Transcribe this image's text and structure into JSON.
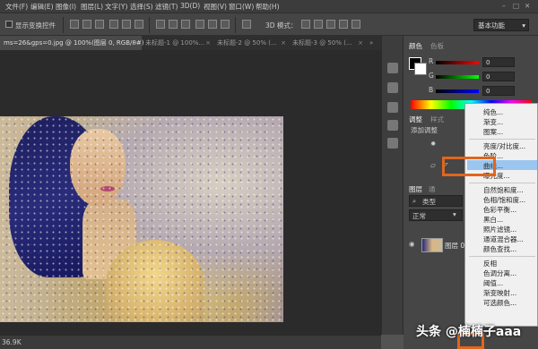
{
  "menubar": {
    "items": [
      "文件(F)",
      "编辑(E)",
      "图像(I)",
      "图层(L)",
      "文字(Y)",
      "选择(S)",
      "滤镜(T)",
      "3D(D)",
      "视图(V)",
      "窗口(W)",
      "帮助(H)"
    ]
  },
  "optionsbar": {
    "show_transform_label": "显示变换控件",
    "mode3d_label": "3D 模式：",
    "workspace_value": "基本功能"
  },
  "tabs": [
    {
      "label": "ms=26&gps=0.jpg @ 100%(图层 0, RGB/8#)",
      "active": true
    },
    {
      "label": "未标题-1 @ 100%...",
      "active": false
    },
    {
      "label": "未标题-2 @ 50% (...",
      "active": false
    },
    {
      "label": "未标题-3 @ 50% (...",
      "active": false
    }
  ],
  "status": {
    "zoom": "36.9K"
  },
  "color_panel": {
    "tabs": [
      "颜色",
      "色板"
    ],
    "rows": [
      {
        "label": "R",
        "value": "0",
        "color": "#e02020"
      },
      {
        "label": "G",
        "value": "0",
        "color": "#20c020"
      },
      {
        "label": "B",
        "value": "0",
        "color": "#2040e0"
      }
    ]
  },
  "adjust_panel": {
    "tabs": [
      "调整",
      "样式"
    ],
    "title": "添加调整"
  },
  "layers_panel": {
    "tabs": [
      "图层",
      "通"
    ],
    "kind_label": "类型",
    "blend_mode": "正常",
    "layer_name": "图层 0"
  },
  "context_menu": {
    "items": [
      {
        "label": "纯色..."
      },
      {
        "label": "渐变..."
      },
      {
        "label": "图案..."
      },
      {
        "sep": true
      },
      {
        "label": "亮度/对比度..."
      },
      {
        "label": "色阶..."
      },
      {
        "label": "曲线...",
        "highlight": true
      },
      {
        "label": "曝光度..."
      },
      {
        "sep": true
      },
      {
        "label": "自然饱和度..."
      },
      {
        "label": "色相/饱和度..."
      },
      {
        "label": "色彩平衡..."
      },
      {
        "label": "黑白..."
      },
      {
        "label": "照片滤镜..."
      },
      {
        "label": "通道混合器..."
      },
      {
        "label": "颜色查找..."
      },
      {
        "sep": true
      },
      {
        "label": "反相"
      },
      {
        "label": "色调分离..."
      },
      {
        "label": "阈值..."
      },
      {
        "label": "渐变映射..."
      },
      {
        "label": "可选颜色..."
      }
    ]
  },
  "watermark": "头条 @楠楠子aaa",
  "colors": {
    "highlight": "#9bc6f0",
    "annotation": "#e0661c"
  }
}
